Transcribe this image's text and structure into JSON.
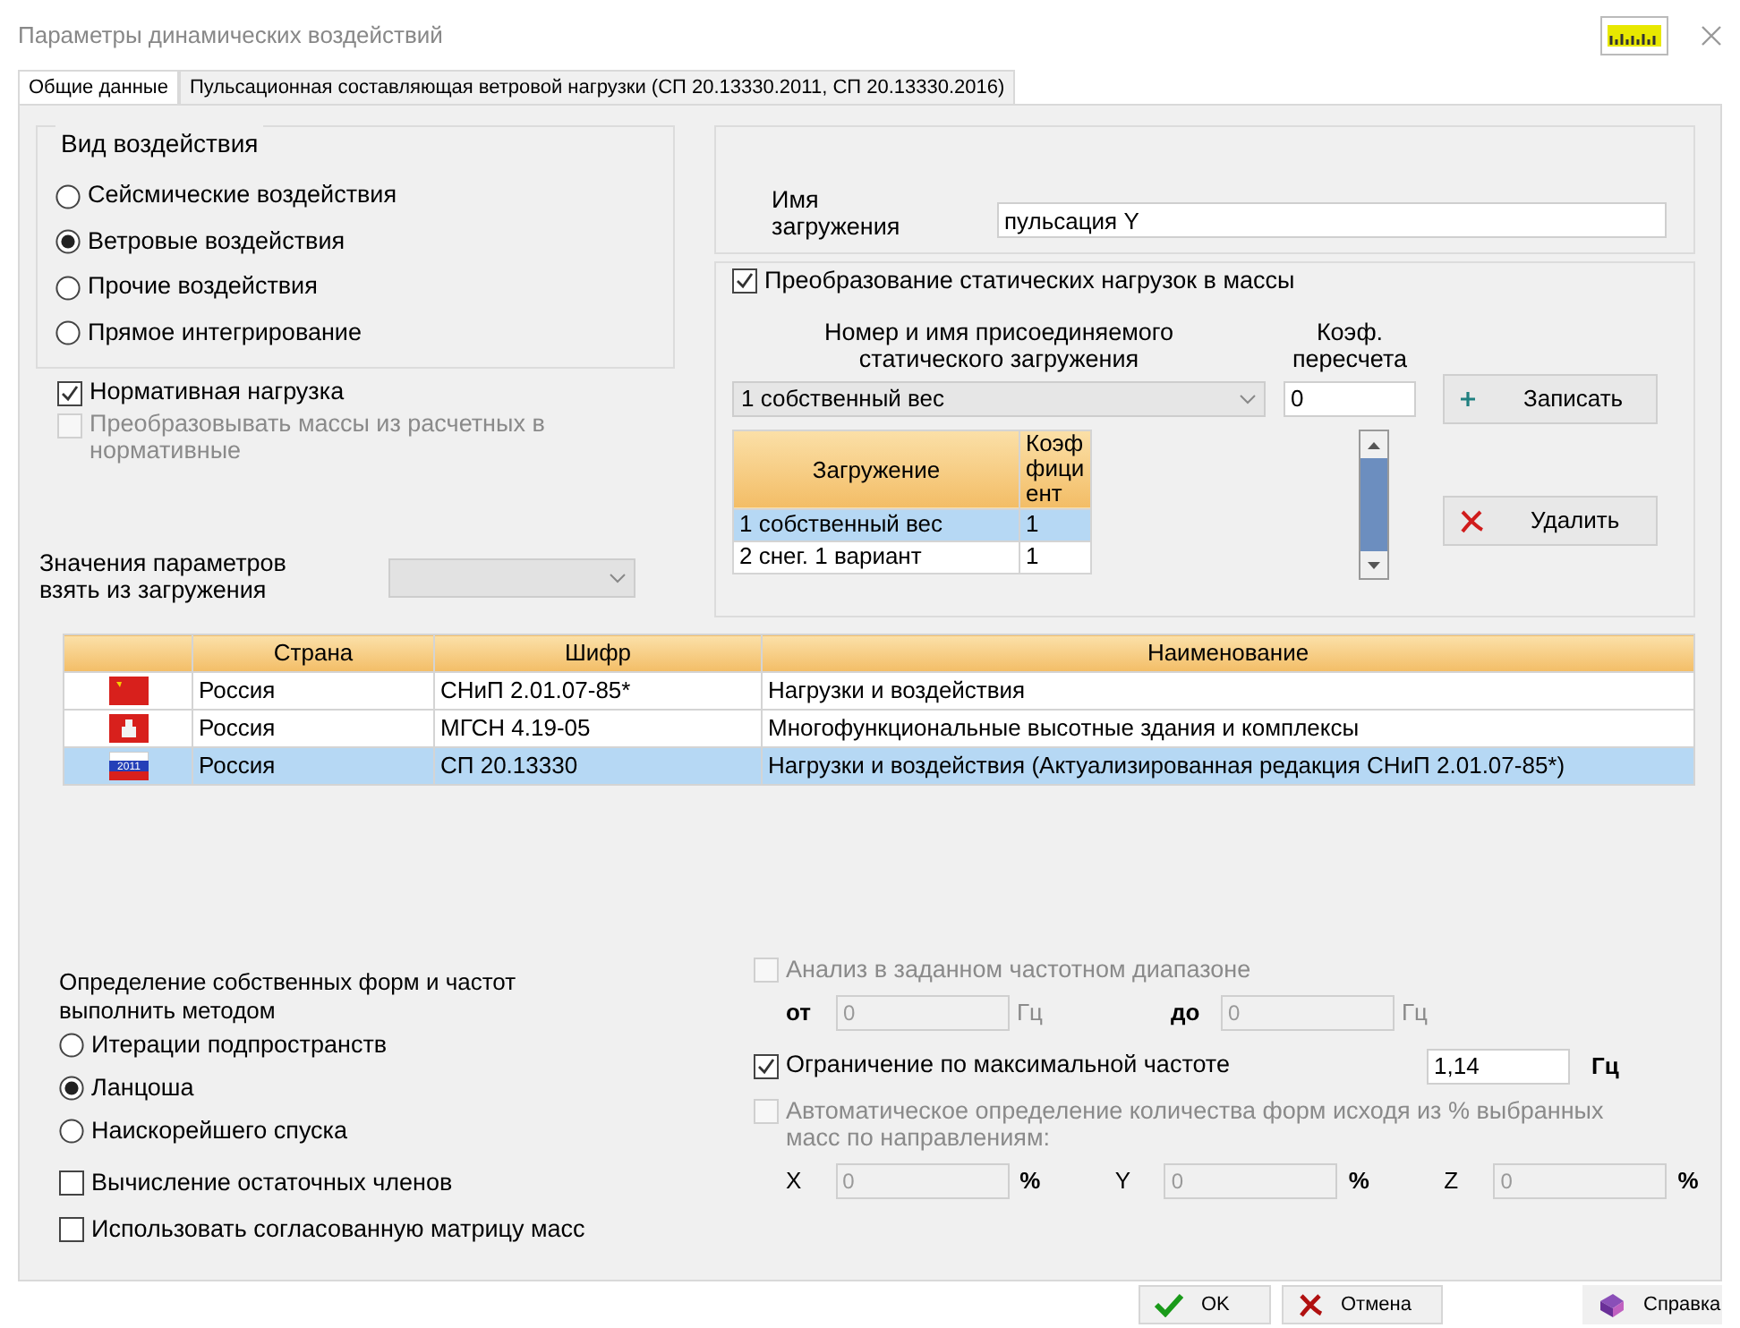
{
  "window": {
    "title": "Параметры динамических воздействий"
  },
  "tabs": [
    {
      "label": "Общие данные",
      "selected": true
    },
    {
      "label": "Пульсационная составляющая ветровой нагрузки (СП 20.13330.2011, СП 20.13330.2016)",
      "selected": false
    }
  ],
  "action_type": {
    "title": "Вид воздействия",
    "options": [
      {
        "label": "Сейсмические воздействия",
        "selected": false
      },
      {
        "label": "Ветровые воздействия",
        "selected": true
      },
      {
        "label": "Прочие воздействия",
        "selected": false
      },
      {
        "label": "Прямое интегрирование",
        "selected": false
      }
    ]
  },
  "normative_checks": [
    {
      "label": "Нормативная нагрузка",
      "checked": true,
      "disabled": false
    },
    {
      "label": "Преобразовывать массы из расчетных в нормативные",
      "checked": false,
      "disabled": true
    }
  ],
  "params_source": {
    "label": "Значения параметров взять из загружения",
    "disabled": true
  },
  "load_name": {
    "label": "Имя загружения",
    "value": "пульсация Y"
  },
  "static_conversion": {
    "label": "Преобразование статических нагрузок в массы",
    "checked": true,
    "load_header": "Номер и имя присоединяемого статического загружения",
    "coef_header": "Коэф. пересчета",
    "load_value": "1 собственный вес",
    "coef_value": "0",
    "buttons": [
      {
        "kind": "add",
        "label": "Записать"
      },
      {
        "kind": "delete",
        "label": "Удалить"
      }
    ],
    "grid": {
      "columns": [
        "Загружение",
        "Коэффициент"
      ],
      "rows": [
        {
          "cells": [
            "1 собственный вес",
            "1"
          ],
          "selected": true
        },
        {
          "cells": [
            "2 снег. 1 вариант",
            "1"
          ],
          "selected": false
        }
      ]
    }
  },
  "norms_table": {
    "columns": [
      "Страна",
      "Шифр",
      "Наименование"
    ],
    "rows": [
      {
        "kind": "ussr",
        "country": "Россия",
        "code": "СНиП 2.01.07-85*",
        "name": "Нагрузки и воздействия",
        "selected": false
      },
      {
        "kind": "moscow",
        "country": "Россия",
        "code": "МГСН 4.19-05",
        "name": "Многофункциональные высотные здания и комплексы",
        "selected": false
      },
      {
        "kind": "russia",
        "flag_text": "2011",
        "country": "Россия",
        "code": "СП 20.13330",
        "name": "Нагрузки и воздействия (Актуализированная редакция СНиП 2.01.07-85*)",
        "selected": true
      }
    ]
  },
  "eigen_method": {
    "label": "Определение собственных форм и частот выполнить методом",
    "options": [
      {
        "label": "Итерации подпространств",
        "selected": false
      },
      {
        "label": "Ланцоша",
        "selected": true
      },
      {
        "label": "Наискорейшего спуска",
        "selected": false
      }
    ]
  },
  "extra_checks": [
    {
      "label": "Вычисление остаточных членов",
      "checked": false
    },
    {
      "label": "Использовать согласованную матрицу масс",
      "checked": false
    }
  ],
  "freq_range": {
    "label": "Анализ в заданном частотном диапазоне",
    "checked": false,
    "disabled": true,
    "from_label": "от",
    "from_value": "0",
    "from_unit": "Гц",
    "to_label": "до",
    "to_value": "0",
    "to_unit": "Гц"
  },
  "max_freq": {
    "label": "Ограничение по максимальной частоте",
    "checked": true,
    "value": "1,14",
    "unit": "Гц"
  },
  "auto_forms": {
    "label": "Автоматическое определение количества форм исходя из % выбранных масс по направлениям:",
    "checked": false,
    "disabled": true,
    "fields": [
      {
        "axis": "X",
        "value": "0",
        "unit": "%"
      },
      {
        "axis": "Y",
        "value": "0",
        "unit": "%"
      },
      {
        "axis": "Z",
        "value": "0",
        "unit": "%"
      }
    ]
  },
  "footer_buttons": [
    {
      "kind": "ok",
      "label": "OK"
    },
    {
      "kind": "cancel",
      "label": "Отмена"
    },
    {
      "kind": "help",
      "label": "Справка"
    }
  ]
}
